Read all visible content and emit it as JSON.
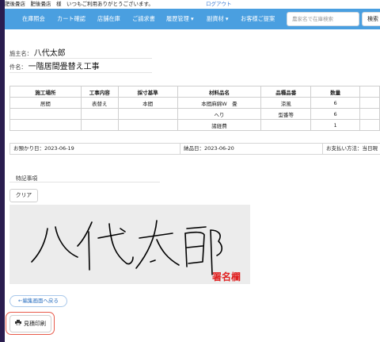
{
  "topbar": {
    "greeting": "肥後畳店　肥後畳店　様　いつもご利用ありがとうございます。",
    "logout": "ログアウト"
  },
  "nav": {
    "items": [
      "在庫照会",
      "カート確認",
      "店舗在庫",
      "ご請求書",
      "履歴管理 ▾",
      "副資材 ▾",
      "お客様ご提案"
    ],
    "search_placeholder": "農家名で在庫検索",
    "search_button": "検索",
    "accent_color": "#4a9fe0"
  },
  "customer": {
    "name_label": "施主名：",
    "name": "八代太郎",
    "subject_label": "件名：",
    "subject": "一階居間畳替え工事"
  },
  "table": {
    "headers": [
      "施工場所",
      "工事内容",
      "採寸基準",
      "材料品名",
      "品種品番",
      "数量",
      ""
    ],
    "rows": [
      [
        "居間",
        "表替え",
        "本間",
        "本間麻綿W　畳",
        "涼風",
        "6",
        ""
      ],
      [
        "",
        "",
        "",
        "へり",
        "型番等",
        "6",
        ""
      ],
      [
        "",
        "",
        "",
        "諸経費",
        "",
        "1",
        ""
      ]
    ]
  },
  "dates": {
    "received": "お預かり日：2023-06-19",
    "delivery": "納品日：2023-06-20",
    "payment": "お支払い方法：当日現"
  },
  "notes_label": "特記事項",
  "clear_button": "クリア",
  "signature_caption": "署名欄",
  "back_button": "←編集画面へ戻る",
  "print_button": "見積印刷",
  "highlight_color": "#e85a4a"
}
